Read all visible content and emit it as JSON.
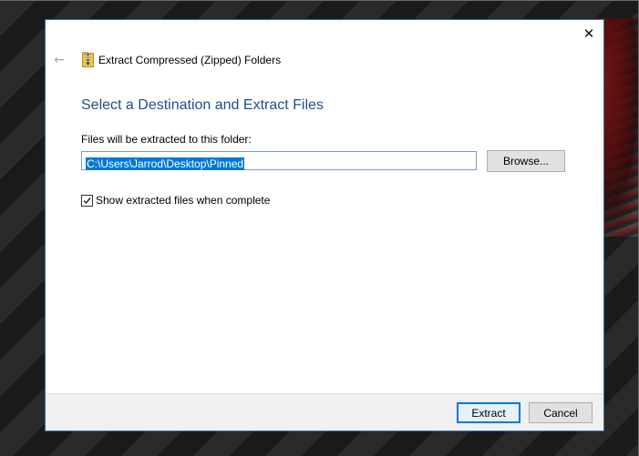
{
  "dialog": {
    "title": "Extract Compressed (Zipped) Folders",
    "close_glyph": "✕",
    "back_glyph": "←",
    "icons": {
      "close": "close-icon",
      "back": "back-arrow-icon",
      "zip": "zip-folder-icon",
      "check": "checkmark-icon"
    }
  },
  "main": {
    "heading": "Select a Destination and Extract Files",
    "folder_label": "Files will be extracted to this folder:",
    "path_value": "C:\\Users\\Jarrod\\Desktop\\Pinned",
    "browse_label": "Browse...",
    "show_files_label": "Show extracted files when complete",
    "show_files_checked": true
  },
  "footer": {
    "extract_label": "Extract",
    "cancel_label": "Cancel"
  },
  "colors": {
    "heading": "#1f4e8c",
    "selection": "#0078d7",
    "default_button_border": "#0078d7"
  }
}
